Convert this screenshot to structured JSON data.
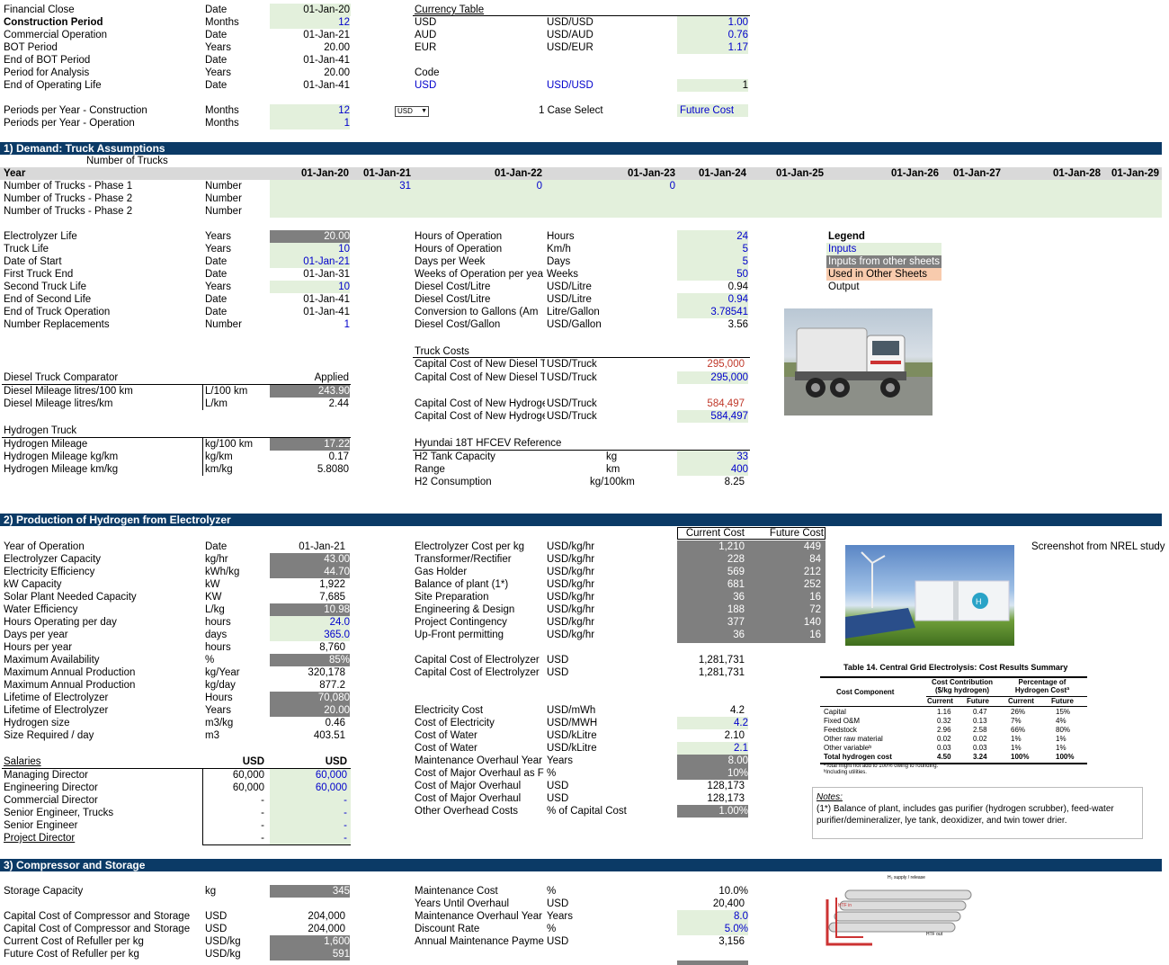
{
  "top": {
    "rows": [
      {
        "label": "Financial Close",
        "unit": "Date",
        "value": "01-Jan-20"
      },
      {
        "label": "Construction Period",
        "unit": "Months",
        "value": "12"
      },
      {
        "label": "Commercial Operation",
        "unit": "Date",
        "value": "01-Jan-21"
      },
      {
        "label": "BOT Period",
        "unit": "Years",
        "value": "20.00"
      },
      {
        "label": "End of BOT Period",
        "unit": "Date",
        "value": "01-Jan-41"
      },
      {
        "label": "Period for Analysis",
        "unit": "Years",
        "value": "20.00"
      },
      {
        "label": "End of Operating Life",
        "unit": "Date",
        "value": "01-Jan-41"
      }
    ],
    "periods": [
      {
        "label": "Periods per Year - Construction",
        "unit": "Months",
        "value": "12"
      },
      {
        "label": "Periods per Year - Operation",
        "unit": "Months",
        "value": "1"
      }
    ],
    "currency_title": "Currency Table",
    "currency": [
      {
        "code": "USD",
        "pair": "USD/USD",
        "value": "1.00"
      },
      {
        "code": "AUD",
        "pair": "USD/AUD",
        "value": "0.76"
      },
      {
        "code": "EUR",
        "pair": "USD/EUR",
        "value": "1.17"
      }
    ],
    "code_label": "Code",
    "code_row": {
      "code": "USD",
      "pair": "USD/USD",
      "value": "1"
    },
    "dropdown_value": "USD",
    "case_label": "1 Case Select",
    "case_value": "Future Cost"
  },
  "s1": {
    "title": "1) Demand: Truck Assumptions",
    "subtitle": "Number of Trucks",
    "year_label": "Year",
    "years": [
      "01-Jan-20",
      "01-Jan-21",
      "01-Jan-22",
      "01-Jan-23",
      "01-Jan-24",
      "01-Jan-25",
      "01-Jan-26",
      "01-Jan-27",
      "01-Jan-28",
      "01-Jan-29"
    ],
    "phases": [
      {
        "label": "Number of Trucks - Phase 1",
        "unit": "Number"
      },
      {
        "label": "Number of Trucks - Phase 2",
        "unit": "Number"
      },
      {
        "label": "Number of Trucks - Phase 2",
        "unit": "Number"
      }
    ],
    "phase1_values": [
      "31",
      "0",
      "0"
    ],
    "left": [
      {
        "label": "Electrolyzer Life",
        "unit": "Years",
        "value": "20.00"
      },
      {
        "label": "Truck Life",
        "unit": "Years",
        "value": "10"
      },
      {
        "label": "Date of Start",
        "unit": "Date",
        "value": "01-Jan-21"
      },
      {
        "label": "First Truck End",
        "unit": "Date",
        "value": "01-Jan-31"
      },
      {
        "label": "Second Truck Life",
        "unit": "Years",
        "value": "10"
      },
      {
        "label": "End of Second Life",
        "unit": "Date",
        "value": "01-Jan-41"
      },
      {
        "label": "End of Truck Operation",
        "unit": "Date",
        "value": "01-Jan-41"
      },
      {
        "label": "Number Replacements",
        "unit": "Number",
        "value": "1"
      }
    ],
    "mid": [
      {
        "label": "Hours of Operation",
        "unit": "Hours",
        "value": "24"
      },
      {
        "label": "Hours of Operation",
        "unit": "Km/h",
        "value": "5"
      },
      {
        "label": "Days per Week",
        "unit": "Days",
        "value": "5"
      },
      {
        "label": "Weeks of Operation per yea",
        "unit": "Weeks",
        "value": "50"
      },
      {
        "label": "Diesel Cost/Litre",
        "unit": "USD/Litre",
        "value": "0.94"
      },
      {
        "label": "Diesel Cost/Litre",
        "unit": "USD/Litre",
        "value": "0.94"
      },
      {
        "label": "Conversion to Gallons (Am",
        "unit": "Litre/Gallon",
        "value": "3.78541"
      },
      {
        "label": "Diesel Cost/Gallon",
        "unit": "USD/Gallon",
        "value": "3.56"
      }
    ],
    "legend_title": "Legend",
    "legend": [
      "Inputs",
      "Inputs from other sheets",
      "Used in Other Sheets",
      "Output"
    ],
    "truck_costs_title": "Truck Costs",
    "truck_costs": [
      {
        "label": "Capital Cost of New Diesel T",
        "unit": "USD/Truck",
        "value": "295,000"
      },
      {
        "label": "Capital Cost of New Diesel T",
        "unit": "USD/Truck",
        "value": "295,000"
      },
      {
        "label": "Capital Cost of New Hydroge",
        "unit": "USD/Truck",
        "value": "584,497"
      },
      {
        "label": "Capital Cost of New Hydroge",
        "unit": "USD/Truck",
        "value": "584,497"
      }
    ],
    "diesel_title": "Diesel Truck Comparator",
    "applied": "Applied",
    "diesel": [
      {
        "label": "Diesel Mileage litres/100 km",
        "unit": "L/100 km",
        "value": "243.90"
      },
      {
        "label": "Diesel Mileage litres/km",
        "unit": "L/km",
        "value": "2.44"
      }
    ],
    "hydrogen_title": "Hydrogen Truck",
    "hydrogen": [
      {
        "label": "Hydrogen Mileage",
        "unit": "kg/100 km",
        "value": "17.22"
      },
      {
        "label": "Hydrogen Mileage kg/km",
        "unit": "kg/km",
        "value": "0.17"
      },
      {
        "label": "Hydrogen Mileage km/kg",
        "unit": "km/kg",
        "value": "5.8080"
      }
    ],
    "hyundai_title": "Hyundai 18T HFCEV Reference",
    "hyundai": [
      {
        "label": "H2 Tank Capacity",
        "unit": "kg",
        "value": "33"
      },
      {
        "label": "Range",
        "unit": "km",
        "value": "400"
      },
      {
        "label": "H2 Consumption",
        "unit": "kg/100km",
        "value": "8.25"
      }
    ]
  },
  "s2": {
    "title": "2) Production of Hydrogen from Electrolyzer",
    "left": [
      {
        "label": "Year of Operation",
        "unit": "Date",
        "value": "01-Jan-21"
      },
      {
        "label": "Electrolyzer Capacity",
        "unit": "kg/hr",
        "value": "43.00"
      },
      {
        "label": "Electricity Efficiency",
        "unit": "kWh/kg",
        "value": "44.70"
      },
      {
        "label": "kW Capacity",
        "unit": "kW",
        "value": "1,922"
      },
      {
        "label": "Solar Plant Needed Capacity",
        "unit": "KW",
        "value": "7,685"
      },
      {
        "label": "Water Efficiency",
        "unit": "L/kg",
        "value": "10.98"
      },
      {
        "label": "Hours Operating per day",
        "unit": "hours",
        "value": "24.0"
      },
      {
        "label": "Days per year",
        "unit": "days",
        "value": "365.0"
      },
      {
        "label": "Hours per year",
        "unit": "hours",
        "value": "8,760"
      },
      {
        "label": "Maximum Availability",
        "unit": "%",
        "value": "85%"
      },
      {
        "label": "Maximum Annual Production",
        "unit": "kg/Year",
        "value": "320,178"
      },
      {
        "label": "Maximum Annual Production",
        "unit": "kg/day",
        "value": "877.2"
      },
      {
        "label": "Lifetime of Electrolyzer",
        "unit": "Hours",
        "value": "70,080"
      },
      {
        "label": "Lifetime of Electrolyzer",
        "unit": "Years",
        "value": "20.00"
      },
      {
        "label": "Hydrogen size",
        "unit": "m3/kg",
        "value": "0.46"
      },
      {
        "label": "Size Required / day",
        "unit": "m3",
        "value": "403.51"
      }
    ],
    "cost_headers": [
      "Current Cost",
      "Future Cost"
    ],
    "costs": [
      {
        "label": "Electrolyzer Cost per kg",
        "unit": "USD/kg/hr",
        "cur": "1,210",
        "fut": "449"
      },
      {
        "label": "Transformer/Rectifier",
        "unit": "USD/kg/hr",
        "cur": "228",
        "fut": "84"
      },
      {
        "label": "Gas Holder",
        "unit": "USD/kg/hr",
        "cur": "569",
        "fut": "212"
      },
      {
        "label": "Balance of plant (1*)",
        "unit": "USD/kg/hr",
        "cur": "681",
        "fut": "252"
      },
      {
        "label": "Site Preparation",
        "unit": "USD/kg/hr",
        "cur": "36",
        "fut": "16"
      },
      {
        "label": "Engineering & Design",
        "unit": "USD/kg/hr",
        "cur": "188",
        "fut": "72"
      },
      {
        "label": "Project Contingency",
        "unit": "USD/kg/hr",
        "cur": "377",
        "fut": "140"
      },
      {
        "label": "Up-Front permitting",
        "unit": "USD/kg/hr",
        "cur": "36",
        "fut": "16"
      }
    ],
    "capital": [
      {
        "label": "Capital Cost of Electrolyzer",
        "unit": "USD",
        "value": "1,281,731"
      },
      {
        "label": "Capital Cost of Electrolyzer",
        "unit": "USD",
        "value": "1,281,731"
      }
    ],
    "elec": [
      {
        "label": "Electricity Cost",
        "unit": "USD/mWh",
        "value": "4.2"
      },
      {
        "label": "Cost of Electricity",
        "unit": "USD/MWH",
        "value": "4.2"
      },
      {
        "label": "Cost of Water",
        "unit": "USD/kLitre",
        "value": "2.10"
      },
      {
        "label": "Cost of Water",
        "unit": "USD/kLitre",
        "value": "2.1"
      },
      {
        "label": "Maintenance Overhaul Year",
        "unit": "Years",
        "value": "8.00"
      },
      {
        "label": "Cost of Major Overhaul as F",
        "unit": "%",
        "value": "10%"
      },
      {
        "label": "Cost of Major Overhaul",
        "unit": "USD",
        "value": "128,173"
      },
      {
        "label": "Cost of Major Overhaul",
        "unit": "USD",
        "value": "128,173"
      },
      {
        "label": "Other Overhead Costs",
        "unit": "% of Capital Cost",
        "value": "1.00%"
      }
    ],
    "salaries_title": "Salaries",
    "salary_headers": [
      "USD",
      "USD"
    ],
    "salaries": [
      {
        "label": "Managing Director",
        "a": "60,000",
        "b": "60,000"
      },
      {
        "label": "Engineering Director",
        "a": "60,000",
        "b": "60,000"
      },
      {
        "label": "Commercial Director",
        "a": "-",
        "b": "-"
      },
      {
        "label": "Senior Engineer, Trucks",
        "a": "-",
        "b": "-"
      },
      {
        "label": "Senior Engineer",
        "a": "-",
        "b": "-"
      },
      {
        "label": "Project Director",
        "a": "-",
        "b": "-"
      }
    ],
    "screenshot_note": "Screenshot from NREL study",
    "table14_title": "Table 14. Central Grid Electrolysis: Cost Results Summary",
    "table14_h1": [
      "Cost Component",
      "Cost Contribution ($/kg hydrogen)",
      "Percentage of Hydrogen Costª"
    ],
    "table14_h2": [
      "Current",
      "Future",
      "Current",
      "Future"
    ],
    "table14_rows": [
      [
        "Capital",
        "1.16",
        "0.47",
        "26%",
        "15%"
      ],
      [
        "Fixed O&M",
        "0.32",
        "0.13",
        "7%",
        "4%"
      ],
      [
        "Feedstock",
        "2.96",
        "2.58",
        "66%",
        "80%"
      ],
      [
        "Other raw material",
        "0.02",
        "0.02",
        "1%",
        "1%"
      ],
      [
        "Other variableᵇ",
        "0.03",
        "0.03",
        "1%",
        "1%"
      ],
      [
        "Total hydrogen cost",
        "4.50",
        "3.24",
        "100%",
        "100%"
      ]
    ],
    "table14_foot": [
      "ªTotal might not add to 100% owing to rounding.",
      "ᵇIncluding utilities."
    ],
    "notes_title": "Notes:",
    "notes_text": "(1*) Balance of plant, includes gas purifier (hydrogen scrubber), feed-water purifier/demineralizer, lye tank, deoxidizer, and twin tower drier."
  },
  "s3": {
    "title": "3) Compressor and Storage",
    "left": [
      {
        "label": "Storage Capacity",
        "unit": "kg",
        "value": "345"
      },
      {
        "label": "Capital Cost of Compressor and Storage",
        "unit": "USD",
        "value": "204,000"
      },
      {
        "label": "Capital Cost of Compressor and Storage",
        "unit": "USD",
        "value": "204,000"
      },
      {
        "label": "Current Cost of Refuller per kg",
        "unit": "USD/kg",
        "value": "1,600"
      },
      {
        "label": "Future Cost of Refuller per kg",
        "unit": "USD/kg",
        "value": "591"
      }
    ],
    "mid": [
      {
        "label": "Maintenance Cost",
        "unit": "%",
        "value": "10.0%"
      },
      {
        "label": "Years Until Overhaul",
        "unit": "USD",
        "value": "20,400"
      },
      {
        "label": "Maintenance Overhaul Year",
        "unit": "Years",
        "value": "8.0"
      },
      {
        "label": "Discount Rate",
        "unit": "%",
        "value": "5.0%"
      },
      {
        "label": "Annual Maintenance Payme",
        "unit": "USD",
        "value": "3,156"
      }
    ],
    "diagram_labels": [
      "H₂ supply / release",
      "HTF in",
      "HTF out"
    ]
  },
  "colors": {
    "header": "#0b3a66",
    "input": "#e3f0dc",
    "linked": "#7f7f7f",
    "used": "#f8cbad",
    "blue": "#0000cc",
    "red": "#c0392b"
  }
}
